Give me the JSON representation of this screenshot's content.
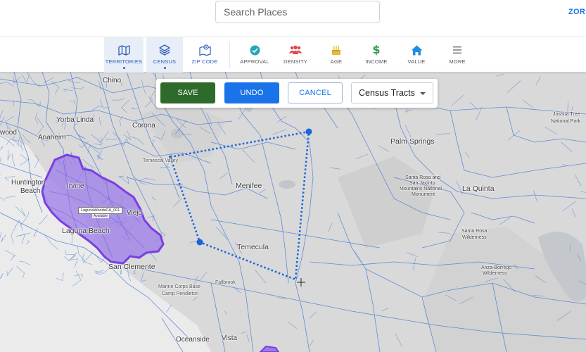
{
  "header": {
    "search_placeholder": "Search Places",
    "brand": "ZORS"
  },
  "toolbar": {
    "items": [
      {
        "label": "TERRITORIES",
        "icon": "map-icon",
        "active": true
      },
      {
        "label": "CENSUS",
        "icon": "layers-icon",
        "active": true
      },
      {
        "label": "ZIP CODE",
        "icon": "zip-map-icon",
        "active": false
      },
      {
        "label": "APPROVAL",
        "icon": "check-circle-icon",
        "active": false
      },
      {
        "label": "DENSITY",
        "icon": "people-icon",
        "active": false
      },
      {
        "label": "AGE",
        "icon": "cake-icon",
        "active": false
      },
      {
        "label": "INCOME",
        "icon": "dollar-icon",
        "active": false
      },
      {
        "label": "VALUE",
        "icon": "home-icon",
        "active": false
      },
      {
        "label": "MORE",
        "icon": "menu-icon",
        "active": false
      }
    ]
  },
  "actions": {
    "save": "SAVE",
    "undo": "UNDO",
    "cancel": "CANCEL",
    "layer_select": "Census Tracts"
  },
  "map": {
    "territory": {
      "name": "LagunaWoodsCA_001",
      "status": "Available"
    },
    "places": {
      "chino": "Chino",
      "yorba_linda": "Yorba Linda",
      "anaheim": "Anaheim",
      "wood": "wood",
      "corona": "Corona",
      "huntington": "Huntington",
      "beach": "Beach",
      "irvine": "Irvine",
      "viejo": "Viejo",
      "laguna_beach": "Laguna Beach",
      "san_clemente": "San Clemente",
      "temescal_valley": "Temescal Valley",
      "menifee": "Menifee",
      "temecula": "Temecula",
      "fallbrook": "Fallbrook",
      "marine_corps": "Marine Corps Base",
      "camp_pendleton": "Camp Pendleton",
      "oceanside": "Oceanside",
      "vista": "Vista",
      "palm_springs": "Palm Springs",
      "la_quinta": "La Quinta",
      "joshua_tree": "Joshua Tree",
      "national_park": "National Park",
      "santa_rosa_san_jacinto_1": "Santa Rosa and",
      "santa_rosa_san_jacinto_2": "San Jacinto",
      "santa_rosa_san_jacinto_3": "Mountains National",
      "santa_rosa_san_jacinto_4": "Monument",
      "santa_rosa_wilderness_1": "Santa Rosa",
      "santa_rosa_wilderness_2": "Wilderness",
      "anza_borrego_1": "Anza-Borrego",
      "anza_borrego_2": "Wilderness"
    }
  },
  "colors": {
    "save": "#2e6b2b",
    "undo": "#1a73e8",
    "territory_fill": "#9b7be8",
    "territory_stroke": "#7a3fe0",
    "tract_lines": "#4a7fd4",
    "polygon_draw": "#1a66d8"
  }
}
